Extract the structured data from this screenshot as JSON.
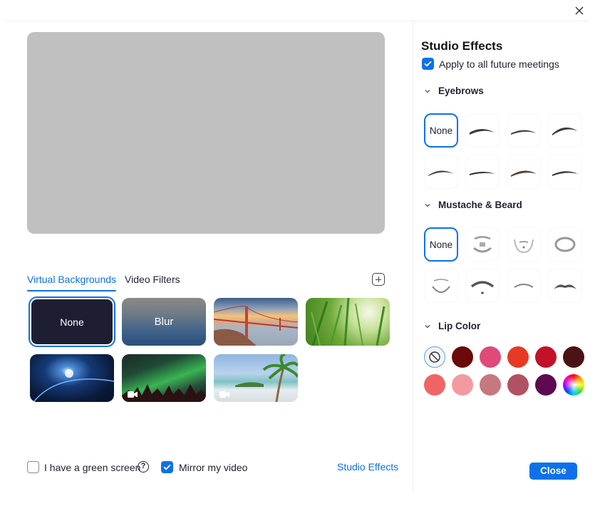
{
  "window": {
    "close_icon": "close-x-icon"
  },
  "preview": {
    "state": "empty"
  },
  "tabs": [
    {
      "label": "Virtual Backgrounds",
      "active": true
    },
    {
      "label": "Video Filters",
      "active": false
    }
  ],
  "add_background_icon": "plus-square-icon",
  "backgrounds": [
    {
      "name": "None",
      "label": "None",
      "selected": true,
      "type": "none"
    },
    {
      "name": "Blur",
      "label": "Blur",
      "selected": false,
      "type": "blur"
    },
    {
      "name": "Golden Gate Bridge",
      "label": "",
      "selected": false,
      "type": "image"
    },
    {
      "name": "Grass",
      "label": "",
      "selected": false,
      "type": "image"
    },
    {
      "name": "Earth",
      "label": "",
      "selected": false,
      "type": "image"
    },
    {
      "name": "Aurora",
      "label": "",
      "selected": false,
      "type": "video"
    },
    {
      "name": "Beach",
      "label": "",
      "selected": false,
      "type": "video"
    }
  ],
  "bottom": {
    "green_screen_label": "I have a green screen",
    "green_screen_checked": false,
    "help_icon": "?",
    "mirror_label": "Mirror my video",
    "mirror_checked": true,
    "studio_effects_link": "Studio Effects"
  },
  "studio": {
    "title": "Studio Effects",
    "apply_future_label": "Apply to all future meetings",
    "apply_future_checked": true,
    "sections": {
      "eyebrows": {
        "title": "Eyebrows",
        "none_label": "None",
        "count": 8
      },
      "beard": {
        "title": "Mustache & Beard",
        "none_label": "None",
        "count": 8
      },
      "lip": {
        "title": "Lip Color"
      }
    },
    "lip_colors": [
      "none",
      "#6b0a0a",
      "#e04a78",
      "#e63b22",
      "#c4112a",
      "#4a1214",
      "#ef6565",
      "#f39aa0",
      "#c77780",
      "#b05262",
      "#5e0a50",
      "rainbow"
    ]
  },
  "close_button": "Close",
  "colors": {
    "accent": "#0e71eb"
  }
}
